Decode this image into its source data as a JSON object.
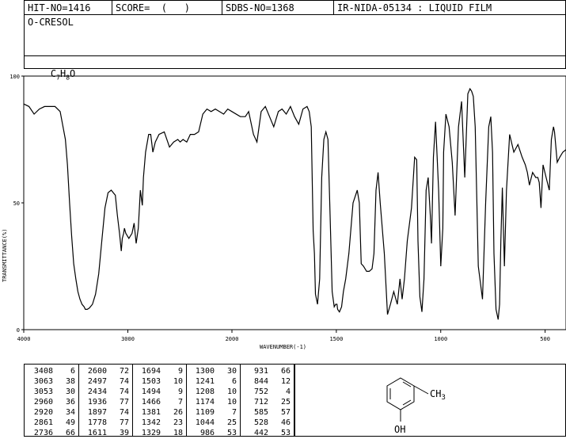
{
  "header": {
    "hit_no": "HIT-NO=1416",
    "score": "SCORE=  (   )",
    "sdbs_no": "SDBS-NO=1368",
    "source": "IR-NIDA-05134 : LIQUID FILM"
  },
  "compound": {
    "name": "O-CRESOL",
    "formula_c": "C",
    "formula_c_sub": "7",
    "formula_h": "H",
    "formula_h_sub": "8",
    "formula_o": "O"
  },
  "chart_data": {
    "type": "line",
    "xlabel": "WAVENUMBER(-1)",
    "ylabel": "TRANSMITTANCE(%)",
    "xlim": [
      4000,
      400
    ],
    "ylim": [
      0,
      100
    ],
    "x_ticks": [
      "4000",
      "3000",
      "2000",
      "1500",
      "1000",
      "500"
    ],
    "y_ticks": [
      "100",
      "50",
      "0"
    ],
    "series": [
      {
        "x": [
          4000,
          3950,
          3900,
          3850,
          3800,
          3750,
          3700,
          3650,
          3600,
          3580,
          3560,
          3540,
          3520,
          3500,
          3480,
          3460,
          3440,
          3420,
          3408,
          3390,
          3370,
          3340,
          3310,
          3280,
          3250,
          3220,
          3190,
          3160,
          3120,
          3100,
          3080,
          3063,
          3053,
          3040,
          3033,
          3020,
          2990,
          2960,
          2940,
          2920,
          2900,
          2880,
          2861,
          2850,
          2830,
          2800,
          2780,
          2760,
          2736,
          2700,
          2650,
          2600,
          2560,
          2520,
          2497,
          2470,
          2434,
          2400,
          2360,
          2320,
          2280,
          2240,
          2200,
          2160,
          2120,
          2080,
          2040,
          2000,
          1960,
          1936,
          1920,
          1897,
          1880,
          1860,
          1840,
          1820,
          1800,
          1778,
          1760,
          1740,
          1720,
          1700,
          1680,
          1660,
          1640,
          1630,
          1620,
          1611,
          1605,
          1600,
          1590,
          1580,
          1570,
          1560,
          1550,
          1540,
          1530,
          1520,
          1510,
          1503,
          1497,
          1494,
          1485,
          1475,
          1466,
          1455,
          1440,
          1420,
          1400,
          1390,
          1381,
          1370,
          1355,
          1342,
          1329,
          1320,
          1310,
          1300,
          1290,
          1270,
          1255,
          1241,
          1225,
          1208,
          1195,
          1185,
          1174,
          1160,
          1140,
          1125,
          1115,
          1109,
          1100,
          1090,
          1080,
          1070,
          1060,
          1050,
          1044,
          1035,
          1025,
          1010,
          1000,
          990,
          986,
          975,
          960,
          945,
          931,
          915,
          900,
          885,
          870,
          860,
          852,
          844,
          835,
          820,
          800,
          785,
          770,
          760,
          752,
          745,
          735,
          725,
          718,
          712,
          705,
          695,
          685,
          670,
          650,
          630,
          610,
          595,
          585,
          575,
          560,
          545,
          535,
          528,
          520,
          510,
          495,
          480,
          470,
          460,
          455,
          442,
          430,
          415,
          400
        ],
        "y": [
          89,
          88,
          85,
          87,
          88,
          88,
          88,
          86,
          75,
          65,
          50,
          37,
          26,
          20,
          15,
          12,
          10,
          9,
          8,
          8,
          8.5,
          10,
          14,
          22,
          35,
          48,
          54,
          55,
          53,
          45,
          38,
          31,
          36,
          38,
          40,
          38,
          36,
          38,
          42,
          34,
          40,
          55,
          49,
          60,
          70,
          77,
          77,
          70,
          74,
          77,
          78,
          72,
          74,
          75,
          74,
          75,
          74,
          77,
          77,
          78,
          85,
          87,
          86,
          87,
          86,
          85,
          87,
          86,
          84,
          84,
          86,
          77,
          74,
          86,
          88,
          84,
          80,
          86,
          87,
          85,
          88,
          84,
          81,
          87,
          88,
          86,
          80,
          39,
          30,
          14,
          10,
          20,
          60,
          75,
          78,
          75,
          45,
          15,
          9,
          10,
          10,
          8,
          7,
          9,
          15,
          20,
          30,
          50,
          55,
          50,
          26,
          25,
          23,
          23,
          24,
          30,
          55,
          62,
          50,
          30,
          6,
          10,
          15,
          10,
          20,
          12,
          20,
          35,
          48,
          68,
          67,
          35,
          13,
          7,
          20,
          55,
          60,
          45,
          34,
          68,
          82,
          55,
          25,
          40,
          70,
          85,
          80,
          66,
          45,
          80,
          90,
          60,
          93,
          95,
          94,
          92,
          80,
          25,
          12,
          50,
          80,
          84,
          70,
          30,
          8,
          4,
          10,
          35,
          56,
          25,
          55,
          77,
          70,
          73,
          68,
          65,
          62,
          57,
          62,
          60,
          60,
          58,
          48,
          65,
          60,
          55,
          75,
          80,
          78,
          66,
          68,
          70,
          71
        ]
      }
    ]
  },
  "peaks": {
    "columns": [
      [
        [
          "3408",
          "6"
        ],
        [
          "3063",
          "38"
        ],
        [
          "3053",
          "30"
        ],
        [
          "2960",
          "36"
        ],
        [
          "2920",
          "34"
        ],
        [
          "2861",
          "49"
        ],
        [
          "2736",
          "66"
        ]
      ],
      [
        [
          "2600",
          "72"
        ],
        [
          "2497",
          "74"
        ],
        [
          "2434",
          "74"
        ],
        [
          "1936",
          "77"
        ],
        [
          "1897",
          "74"
        ],
        [
          "1778",
          "77"
        ],
        [
          "1611",
          "39"
        ]
      ],
      [
        [
          "1694",
          "9"
        ],
        [
          "1503",
          "10"
        ],
        [
          "1494",
          "9"
        ],
        [
          "1466",
          "7"
        ],
        [
          "1381",
          "26"
        ],
        [
          "1342",
          "23"
        ],
        [
          "1329",
          "18"
        ]
      ],
      [
        [
          "1300",
          "30"
        ],
        [
          "1241",
          "6"
        ],
        [
          "1208",
          "10"
        ],
        [
          "1174",
          "10"
        ],
        [
          "1109",
          "7"
        ],
        [
          "1044",
          "25"
        ],
        [
          "986",
          "53"
        ]
      ],
      [
        [
          "931",
          "66"
        ],
        [
          "844",
          "12"
        ],
        [
          "752",
          "4"
        ],
        [
          "712",
          "25"
        ],
        [
          "585",
          "57"
        ],
        [
          "528",
          "46"
        ],
        [
          "442",
          "53"
        ]
      ]
    ]
  },
  "structure": {
    "substituent_top": "CH",
    "substituent_top_sub": "3",
    "substituent_bottom": "OH"
  }
}
